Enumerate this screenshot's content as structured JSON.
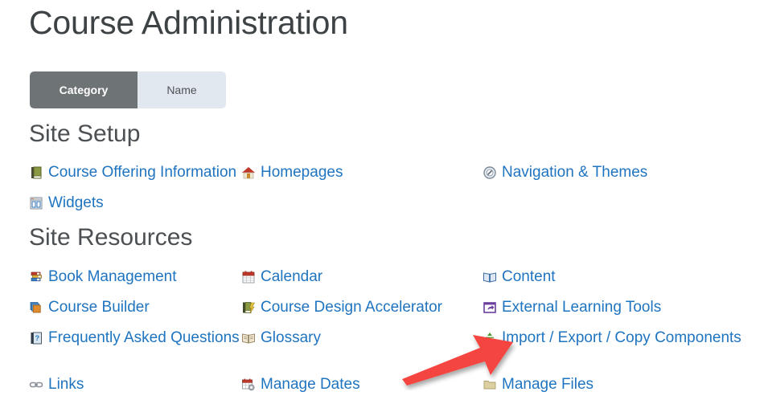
{
  "page": {
    "title": "Course Administration"
  },
  "toggle": {
    "category_label": "Category",
    "name_label": "Name",
    "active": "Category",
    "active_bg": "#6e7376",
    "inactive_bg": "#e2e8ef"
  },
  "colors": {
    "link": "#1f74c0",
    "heading": "#4c5053",
    "title": "#3d4245",
    "arrow": "#f4453f"
  },
  "sections": [
    {
      "heading": "Site Setup",
      "rows": [
        [
          {
            "label": "Course Offering Information",
            "icon": "green-book-icon"
          },
          {
            "label": "Homepages",
            "icon": "house-icon"
          },
          {
            "label": "Navigation & Themes",
            "icon": "compass-icon"
          }
        ],
        [
          {
            "label": "Widgets",
            "icon": "widgets-grid-icon"
          },
          {
            "label": "",
            "icon": ""
          },
          {
            "label": "",
            "icon": ""
          }
        ]
      ]
    },
    {
      "heading": "Site Resources",
      "rows": [
        [
          {
            "label": "Book Management",
            "icon": "stacked-books-icon"
          },
          {
            "label": "Calendar",
            "icon": "calendar-icon"
          },
          {
            "label": "Content",
            "icon": "open-book-blue-icon"
          }
        ],
        [
          {
            "label": "Course Builder",
            "icon": "stacked-squares-icon"
          },
          {
            "label": "Course Design Accelerator",
            "icon": "book-lightning-icon"
          },
          {
            "label": "External Learning Tools",
            "icon": "external-tool-icon"
          }
        ],
        [
          {
            "label": "Frequently Asked Questions",
            "icon": "faq-book-icon"
          },
          {
            "label": "Glossary",
            "icon": "open-book-tan-icon"
          },
          {
            "label": "Import / Export / Copy Components",
            "icon": "import-export-arrows-icon"
          }
        ],
        [
          {
            "label": "Links",
            "icon": "chain-link-icon"
          },
          {
            "label": "Manage Dates",
            "icon": "calendar-gear-icon"
          },
          {
            "label": "Manage Files",
            "icon": "folder-icon"
          }
        ]
      ]
    }
  ],
  "annotation": {
    "type": "red-arrow",
    "points_to": "Import / Export / Copy Components",
    "color": "#f4453f"
  }
}
